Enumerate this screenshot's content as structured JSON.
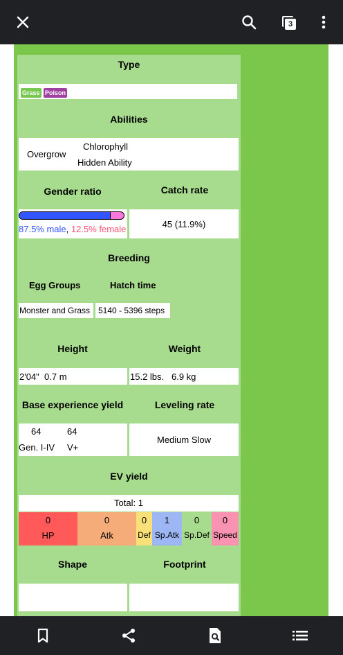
{
  "toolbar": {
    "tab_count": "3",
    "close_icon": "close-icon",
    "search_icon": "search-icon",
    "tabs_icon": "tabs-icon",
    "menu_icon": "more-vert-icon"
  },
  "type": {
    "header": "Type",
    "badges": [
      {
        "label": "Grass",
        "color": "#78c850"
      },
      {
        "label": "Poison",
        "color": "#a040a0"
      }
    ]
  },
  "abilities": {
    "header": "Abilities",
    "primary": "Overgrow",
    "hidden": "Chlorophyll",
    "hidden_label": "Hidden Ability"
  },
  "gender": {
    "header": "Gender ratio",
    "male_pct": 87.5,
    "male_text": "87.5% male",
    "separator": ",",
    "female_text": "12.5% female",
    "male_color": "#3355ff",
    "female_color": "#ff77dd"
  },
  "catch_rate": {
    "header": "Catch rate",
    "value": "45 (11.9%)"
  },
  "breeding": {
    "header": "Breeding",
    "egg_groups_header": "Egg Groups",
    "hatch_time_header": "Hatch time",
    "egg_groups": "Monster and Grass",
    "hatch_time": "5140 - 5396 steps"
  },
  "height": {
    "header": "Height",
    "value": "2'04\"  0.7 m"
  },
  "weight": {
    "header": "Weight",
    "value": "15.2 lbs.   6.9 kg"
  },
  "base_exp": {
    "header": "Base experience yield",
    "gen1_value": "64",
    "gen2_value": "64",
    "gen1_label": "Gen. I-IV",
    "gen2_label": "V+"
  },
  "leveling": {
    "header": "Leveling rate",
    "value": "Medium Slow"
  },
  "ev_yield": {
    "header": "EV yield",
    "total": "Total: 1",
    "stats": [
      {
        "value": "0",
        "label": "HP",
        "color": "#ff5959"
      },
      {
        "value": "0",
        "label": "Atk",
        "color": "#f5ac78"
      },
      {
        "value": "0",
        "label": "Def",
        "color": "#fae078"
      },
      {
        "value": "1",
        "label": "Sp.Atk",
        "color": "#9db7f5"
      },
      {
        "value": "0",
        "label": "Sp.Def",
        "color": "#a7db8d"
      },
      {
        "value": "0",
        "label": "Speed",
        "color": "#fa92b2"
      }
    ]
  },
  "shape": {
    "header": "Shape"
  },
  "footprint": {
    "header": "Footprint"
  },
  "bottom_nav": {
    "bookmark_icon": "bookmark-icon",
    "share_icon": "share-icon",
    "find_icon": "find-in-page-icon",
    "contents_icon": "contents-list-icon"
  }
}
